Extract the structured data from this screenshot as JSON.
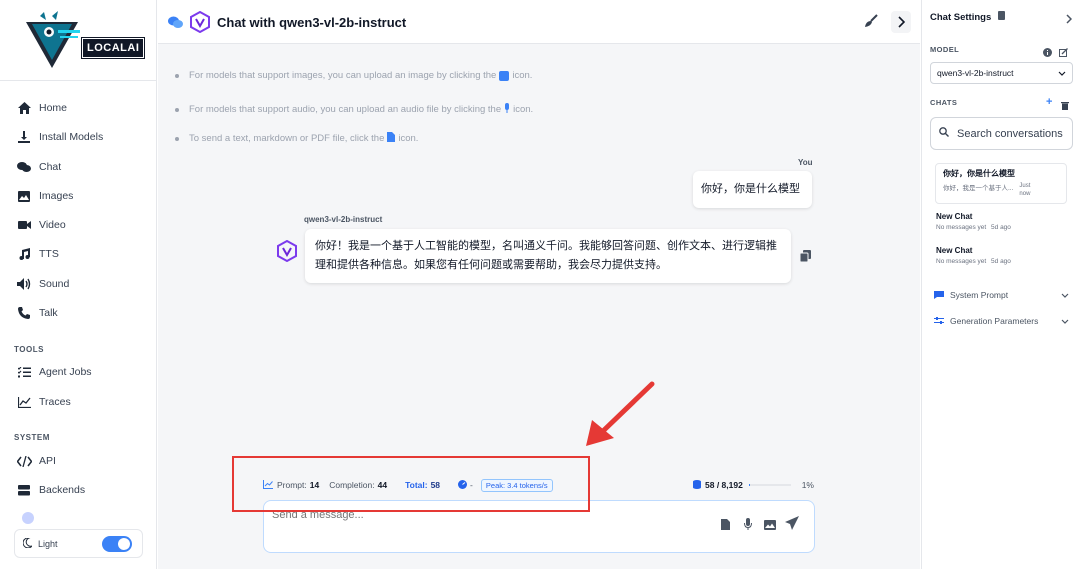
{
  "sidebar": {
    "logo_text": "LOCALAI",
    "items": [
      {
        "label": "Home",
        "icon": "home-icon"
      },
      {
        "label": "Install Models",
        "icon": "download-icon"
      },
      {
        "label": "Chat",
        "icon": "chat-icon"
      },
      {
        "label": "Images",
        "icon": "image-icon"
      },
      {
        "label": "Video",
        "icon": "video-icon"
      },
      {
        "label": "TTS",
        "icon": "music-icon"
      },
      {
        "label": "Sound",
        "icon": "volume-icon"
      },
      {
        "label": "Talk",
        "icon": "phone-icon"
      }
    ],
    "tools_label": "TOOLS",
    "tools": [
      {
        "label": "Agent Jobs",
        "icon": "tasks-icon"
      },
      {
        "label": "Traces",
        "icon": "chart-line-icon"
      }
    ],
    "system_label": "SYSTEM",
    "system": [
      {
        "label": "API",
        "icon": "code-icon"
      },
      {
        "label": "Backends",
        "icon": "server-icon"
      }
    ],
    "theme_label": "Light"
  },
  "header": {
    "title": "Chat with qwen3-vl-2b-instruct"
  },
  "tips": [
    {
      "before": "For models that support images, you can upload an image by clicking the",
      "after": "icon."
    },
    {
      "before": "For models that support audio, you can upload an audio file by clicking the",
      "after": "icon."
    },
    {
      "before": "To send a text, markdown or PDF file, click the",
      "after": "icon."
    }
  ],
  "messages": {
    "user_label": "You",
    "user_text": "你好，你是什么模型",
    "assistant_label": "qwen3-vl-2b-instruct",
    "assistant_text": "你好！我是一个基于人工智能的模型，名叫通义千问。我能够回答问题、创作文本、进行逻辑推理和提供各种信息。如果您有任何问题或需要帮助，我会尽力提供支持。"
  },
  "stats": {
    "prompt_label": "Prompt:",
    "prompt_value": "14",
    "completion_label": "Completion:",
    "completion_value": "44",
    "total_label": "Total:",
    "total_value": "58",
    "dash": "-",
    "peak": "Peak: 3.4 tokens/s",
    "context": "58 / 8,192",
    "context_percent": "1%",
    "context_fraction": 0.01
  },
  "input": {
    "placeholder": "Send a message..."
  },
  "right_panel": {
    "title": "Chat Settings",
    "model_label": "MODEL",
    "model_value": "qwen3-vl-2b-instruct",
    "chats_label": "CHATS",
    "search_placeholder": "Search conversations",
    "chats": [
      {
        "title": "你好，你是什么模型",
        "preview": "你好，我是一个基于人...",
        "time": "Just now"
      },
      {
        "title": "New Chat",
        "preview": "No messages yet",
        "time": "5d ago"
      },
      {
        "title": "New Chat",
        "preview": "No messages yet",
        "time": "5d ago"
      }
    ],
    "system_prompt_label": "System Prompt",
    "gen_params_label": "Generation Parameters"
  },
  "colors": {
    "accent": "#3b82f6",
    "highlight": "#e53935"
  }
}
